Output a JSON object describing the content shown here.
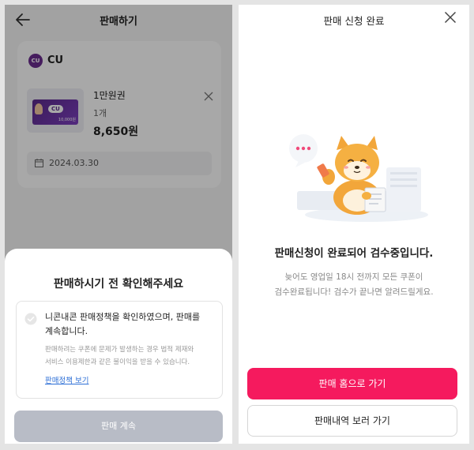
{
  "left": {
    "header": {
      "title": "판매하기"
    },
    "store": {
      "logo_text": "CU",
      "name": "CU"
    },
    "product": {
      "name": "1만원권",
      "quantity": "1개",
      "price": "8,650원",
      "voucher_logo": "CU",
      "voucher_amount": "10,000원"
    },
    "date": "2024.03.30",
    "sheet": {
      "title": "판매하시기 전 확인해주세요",
      "policy_line1": "니콘내콘 판매정책을 확인하였으며, 판매를",
      "policy_line2": "계속합니다.",
      "desc_line1": "판매하려는 쿠폰에 문제가 발생하는 경우 법적 제재와",
      "desc_line2": "서비스 이용제한과 같은 불이익을 받을 수 있습니다.",
      "link": "판매정책 보기",
      "button": "판매 계속"
    }
  },
  "right": {
    "title": "판매 신청 완료",
    "headline": "판매신청이 완료되어 검수중입니다.",
    "desc_line1": "늦어도 영업일 18시 전까지 모든 쿠폰이",
    "desc_line2": "검수완료됩니다! 검수가 끝나면 알려드릴게요.",
    "primary_button": "판매 홈으로 가기",
    "secondary_button": "판매내역 보러 가기"
  },
  "icons": {
    "back": "arrow-left-icon",
    "remove": "close-icon",
    "calendar": "calendar-icon",
    "check": "check-circle-icon",
    "close": "close-icon"
  },
  "colors": {
    "brand_pink": "#f51a5e",
    "disabled_button": "#b8bcc6",
    "link_blue": "#2d6fd6",
    "cu_purple": "#6b2d8f"
  }
}
